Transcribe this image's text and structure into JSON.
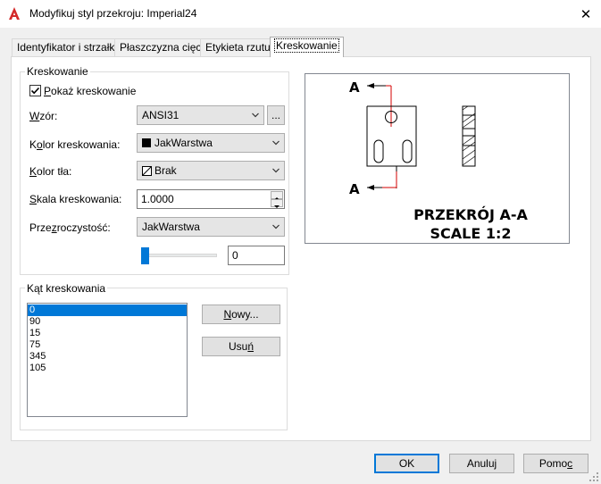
{
  "window": {
    "title": "Modyfikuj styl przekroju: Imperial24",
    "close_glyph": "✕"
  },
  "tabs": [
    {
      "label": "Identyfikator i strzałki"
    },
    {
      "label": "Płaszczyzna cięcia"
    },
    {
      "label": "Etykieta rzutu"
    },
    {
      "label": "Kreskowanie",
      "active": true
    }
  ],
  "hatch": {
    "group_title": "Kreskowanie",
    "show_hatch": {
      "label_prefix": "",
      "label_hot": "P",
      "label_rest": "okaż kreskowanie",
      "checked": true
    },
    "pattern": {
      "label_hot": "W",
      "label_rest": "zór:",
      "value": "ANSI31",
      "browse_label": "..."
    },
    "hatch_color": {
      "label_pre": "K",
      "label_hot": "o",
      "label_rest": "lor kreskowania:",
      "value": "JakWarstwa",
      "swatch": "#000000"
    },
    "bg_color": {
      "label_hot": "K",
      "label_rest": "olor tła:",
      "value": "Brak"
    },
    "scale": {
      "label_hot": "S",
      "label_rest": "kala kreskowania:",
      "value": "1.0000"
    },
    "transparency": {
      "label_pre": "Prze",
      "label_hot": "z",
      "label_rest": "roczystość:",
      "value": "JakWarstwa",
      "slider_value": 0,
      "field_value": "0"
    }
  },
  "angle": {
    "group_title": "Kąt kreskowania",
    "items": [
      "0",
      "90",
      "15",
      "75",
      "345",
      "105"
    ],
    "selected_index": 0,
    "new_label_hot": "N",
    "new_label_rest": "owy...",
    "delete_label_pre": "Usu",
    "delete_label_hot": "ń",
    "delete_label_rest": ""
  },
  "preview": {
    "arrow_label_top": "A",
    "arrow_label_bottom": "A",
    "caption_line1": "PRZEKRÓJ A-A",
    "caption_line2": "SCALE 1:2",
    "accent_color": "#0078d7"
  },
  "buttons": {
    "ok": "OK",
    "cancel": "Anuluj",
    "help_pre": "Pomo",
    "help_hot": "c"
  }
}
